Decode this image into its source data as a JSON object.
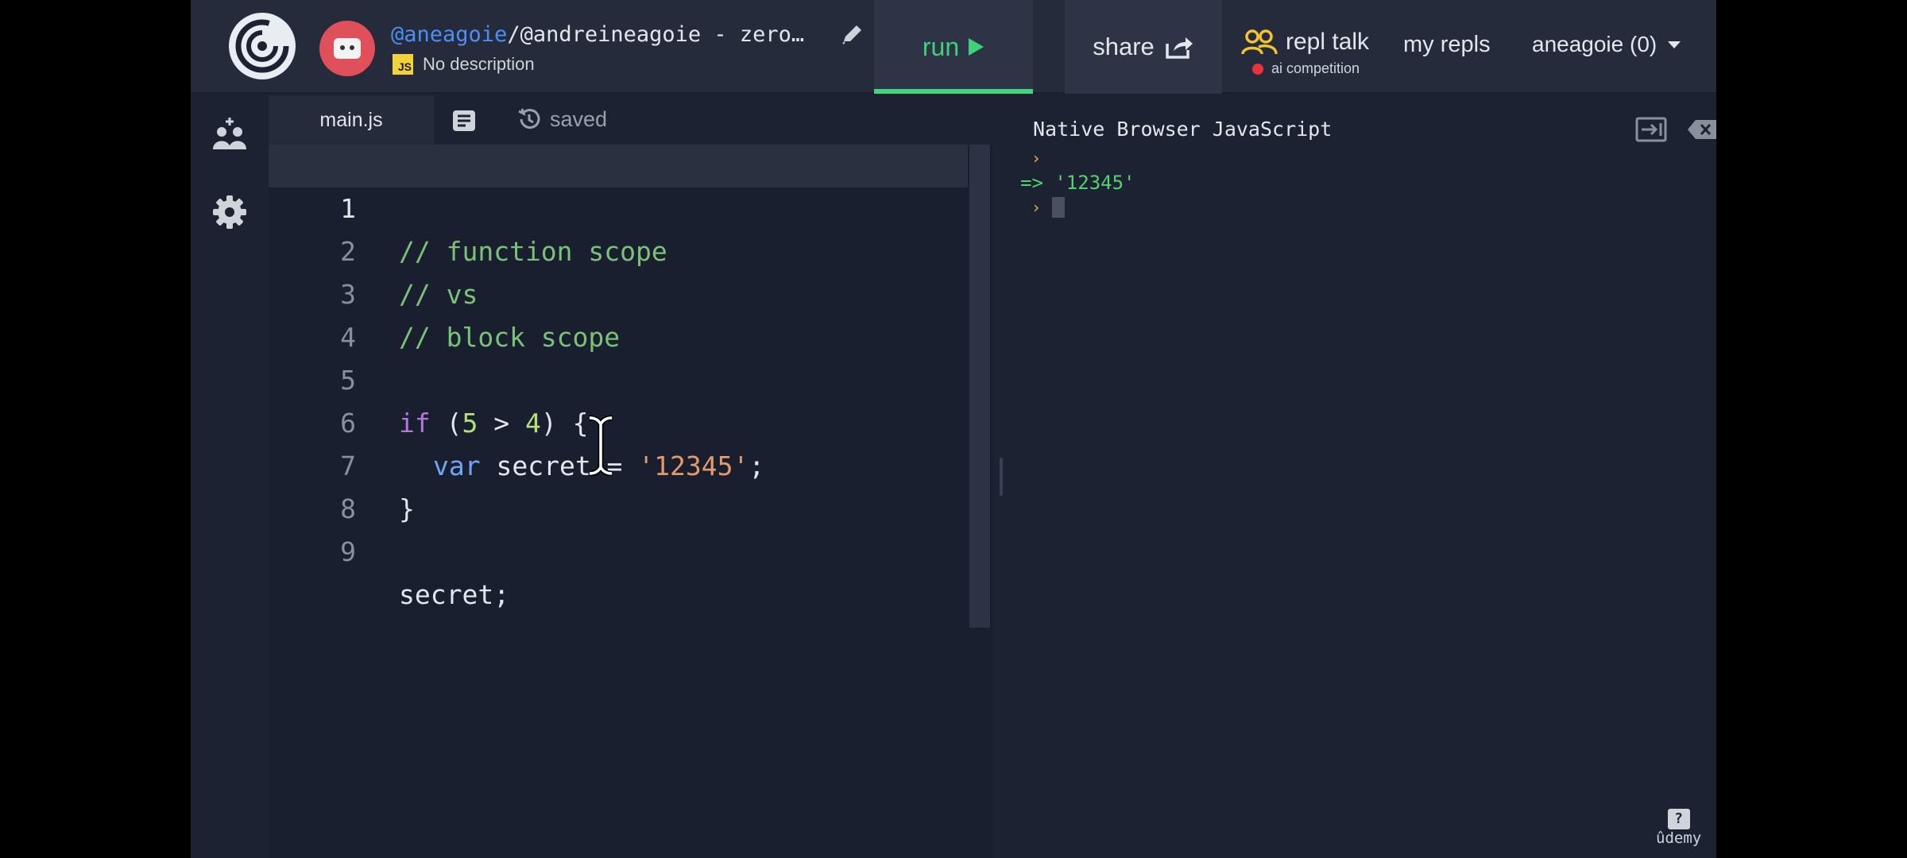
{
  "topbar": {
    "repl_owner": "@aneagoie",
    "repl_title_rest": "/@andreineagoie - zero…",
    "language_badge": "JS",
    "description": "No description",
    "run_label": "run",
    "share_label": "share",
    "talk_label": "repl talk",
    "talk_sub": "ai competition",
    "my_repls": "my repls",
    "user": "aneagoie (0)"
  },
  "editor": {
    "tab_filename": "main.js",
    "saved_status": "saved",
    "lines": [
      {
        "n": "1",
        "code": "// function scope"
      },
      {
        "n": "2",
        "code": "// vs"
      },
      {
        "n": "3",
        "code": "// block scope"
      },
      {
        "n": "4",
        "code": ""
      },
      {
        "n": "5",
        "code": "if (5 > 4) {"
      },
      {
        "n": "6",
        "code": "  var secret = '12345';"
      },
      {
        "n": "7",
        "code": "}"
      },
      {
        "n": "8",
        "code": ""
      },
      {
        "n": "9",
        "code": "secret;"
      }
    ],
    "tokens": {
      "l1": "// function scope",
      "l2": "// vs",
      "l3": "// block scope",
      "l5_kw": "if",
      "l5_open": " (",
      "l5_a": "5",
      "l5_op": " > ",
      "l5_b": "4",
      "l5_close": ") {",
      "l6_kw": "var",
      "l6_mid": " secret = ",
      "l6_str": "'12345'",
      "l6_end": ";",
      "l7": "}",
      "l9": "secret;"
    }
  },
  "console": {
    "title": "Native Browser JavaScript",
    "prompt_glyph": "›",
    "result": "=> '12345'"
  },
  "watermark": {
    "brand": "ûdemy",
    "help": "?"
  },
  "colors": {
    "accent_green": "#44d47d",
    "link_blue": "#4c8ff2",
    "comment_green": "#79c278",
    "string_orange": "#e49a6b"
  }
}
